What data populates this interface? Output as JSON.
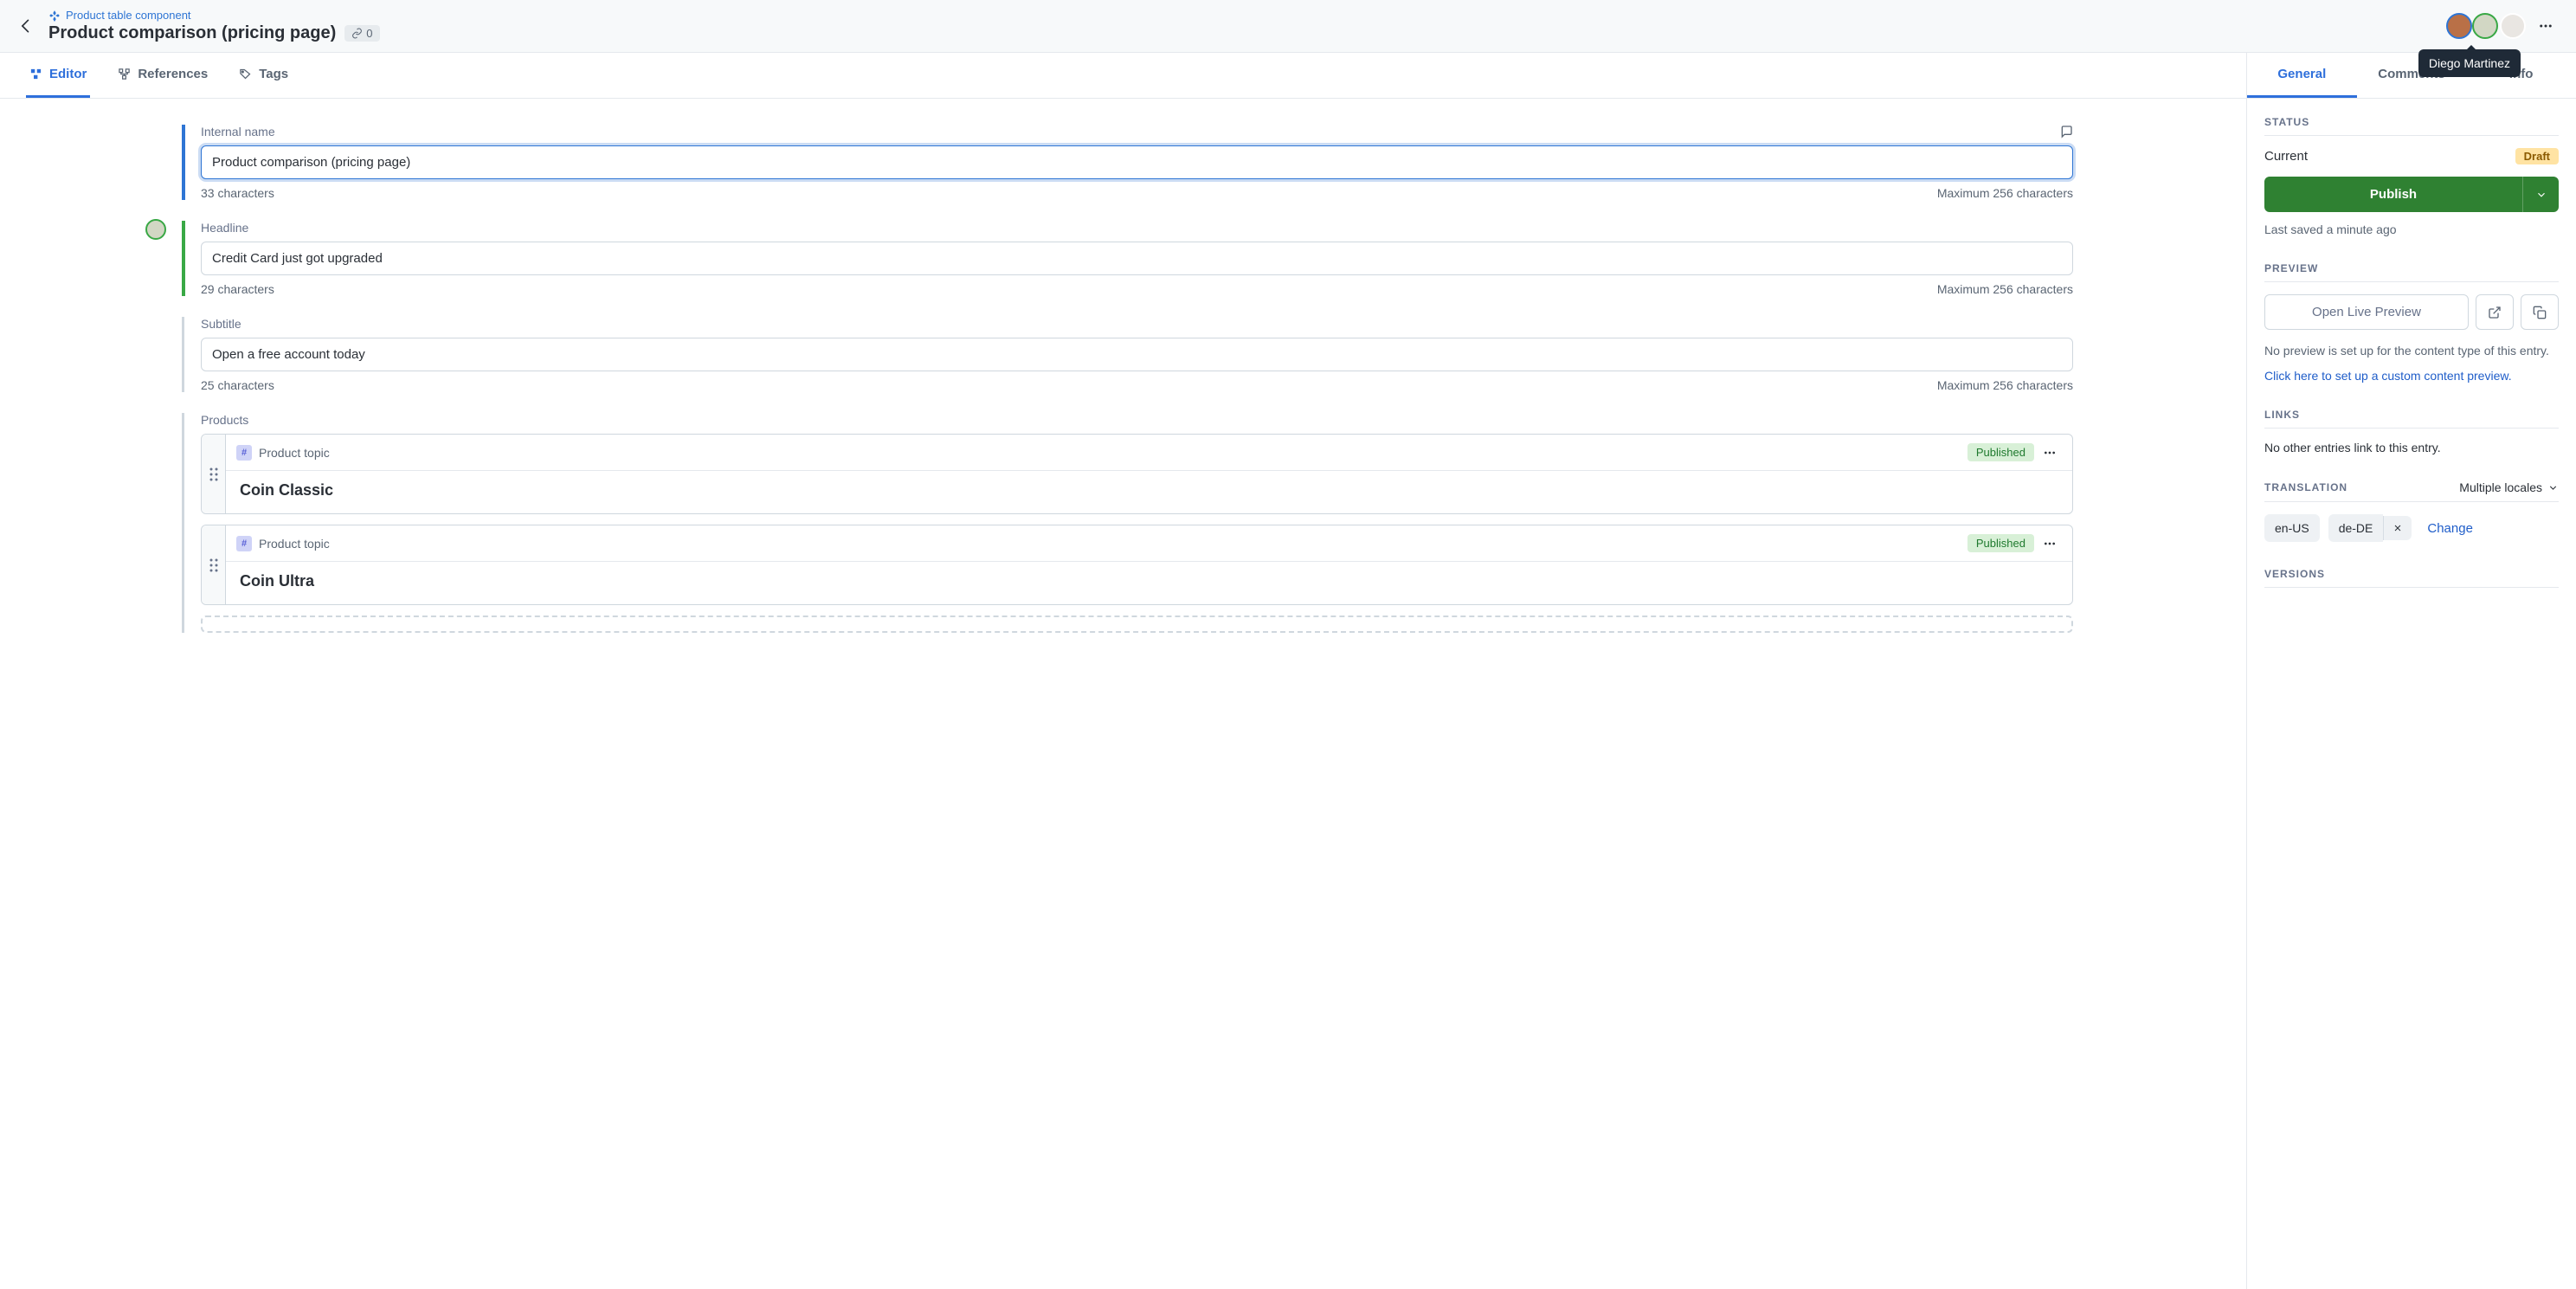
{
  "breadcrumb": {
    "parent": "Product table component"
  },
  "page": {
    "title": "Product comparison (pricing page)",
    "linked_count": "0"
  },
  "collaborators": {
    "tooltip": "Diego Martinez"
  },
  "content_tabs": {
    "editor": "Editor",
    "references": "References",
    "tags": "Tags"
  },
  "fields": {
    "internal_name": {
      "label": "Internal name",
      "value": "Product comparison (pricing page)",
      "count": "33 characters",
      "max": "Maximum 256 characters"
    },
    "headline": {
      "label": "Headline",
      "value": "Credit Card just got upgraded",
      "count": "29 characters",
      "max": "Maximum 256 characters"
    },
    "subtitle": {
      "label": "Subtitle",
      "value": "Open a free account today",
      "count": "25 characters",
      "max": "Maximum 256 characters"
    },
    "products": {
      "label": "Products",
      "type_label": "Product topic",
      "items": [
        {
          "title": "Coin Classic",
          "status": "Published"
        },
        {
          "title": "Coin Ultra",
          "status": "Published"
        }
      ]
    }
  },
  "sidebar_tabs": {
    "general": "General",
    "comments": "Comments",
    "info": "Info"
  },
  "status": {
    "section": "Status",
    "current_label": "Current",
    "badge": "Draft",
    "publish": "Publish",
    "last_saved": "Last saved a minute ago"
  },
  "preview": {
    "section": "Preview",
    "button": "Open Live Preview",
    "message": "No preview is set up for the content type of this entry.",
    "link": "Click here to set up a custom content preview."
  },
  "links": {
    "section": "Links",
    "message": "No other entries link to this entry."
  },
  "translation": {
    "section": "Translation",
    "mode": "Multiple locales",
    "locales": [
      "en-US",
      "de-DE"
    ],
    "change": "Change"
  },
  "versions": {
    "section": "Versions"
  }
}
